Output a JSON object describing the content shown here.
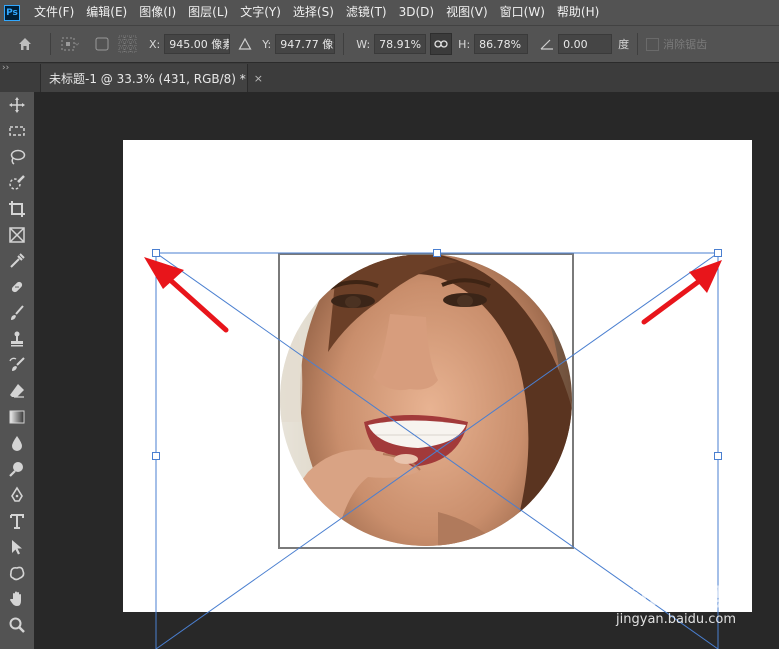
{
  "app": {
    "logo_text": "Ps"
  },
  "menu": [
    "文件(F)",
    "编辑(E)",
    "图像(I)",
    "图层(L)",
    "文字(Y)",
    "选择(S)",
    "滤镜(T)",
    "3D(D)",
    "视图(V)",
    "窗口(W)",
    "帮助(H)"
  ],
  "options": {
    "x_label": "X:",
    "x_value": "945.00 像素",
    "y_label": "Y:",
    "y_value": "947.77 像素",
    "w_label": "W:",
    "w_value": "78.91%",
    "h_label": "H:",
    "h_value": "86.78%",
    "angle_value": "0.00",
    "angle_unit": "度",
    "antialias_label": "消除锯齿"
  },
  "tab_collapse": "››",
  "document_tab": {
    "title": "未标题-1 @ 33.3% (431, RGB/8) *",
    "close": "×"
  },
  "tools": [
    "move-tool",
    "marquee-tool",
    "lasso-tool",
    "quick-select-tool",
    "crop-tool",
    "frame-tool",
    "eyedropper-tool",
    "healing-tool",
    "brush-tool",
    "stamp-tool",
    "history-brush-tool",
    "eraser-tool",
    "gradient-tool",
    "blur-tool",
    "dodge-tool",
    "pen-tool",
    "type-tool",
    "path-select-tool",
    "shape-tool",
    "hand-tool",
    "zoom-tool"
  ],
  "watermark": {
    "logo": "Baidu 经验",
    "url": "jingyan.baidu.com"
  },
  "colors": {
    "menubar": "#535353",
    "workspace": "#282828",
    "transform": "#3d7fd6",
    "arrow": "#e8151b"
  }
}
